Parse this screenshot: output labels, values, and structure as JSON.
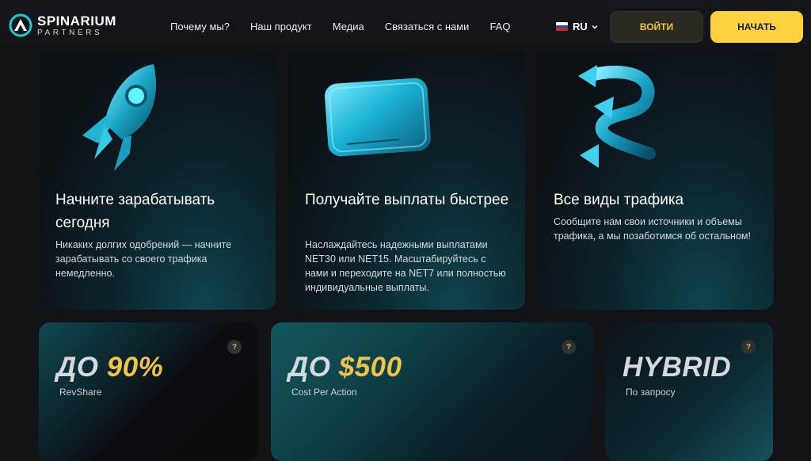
{
  "header": {
    "logo": {
      "title": "SPINARIUM",
      "subtitle": "PARTNERS"
    },
    "nav": [
      "Почему мы?",
      "Наш продукт",
      "Медиа",
      "Связаться с нами",
      "FAQ"
    ],
    "language": "RU",
    "login_label": "ВОЙТИ",
    "start_label": "НАЧАТЬ"
  },
  "features": [
    {
      "title": "Начните зарабатывать сегодня",
      "description": "Никаких долгих одобрений — начните зарабатывать со своего трафика немедленно.",
      "icon": "rocket-icon"
    },
    {
      "title": "Получайте выплаты быстрее",
      "description": "Наслаждайтесь надежными выплатами NET30 или NET15. Масштабируйтесь с нами и переходите на NET7 или полностью индивидуальные выплаты.",
      "icon": "card-icon"
    },
    {
      "title": "Все виды трафика",
      "description": "Сообщите нам свои источники и объемы трафика, а мы позаботимся об остальном!",
      "icon": "arrows-icon"
    }
  ],
  "stats": [
    {
      "prefix": "ДО",
      "value": "90%",
      "label": "RevShare"
    },
    {
      "prefix": "ДО",
      "value": "$500",
      "label": "Cost Per Action"
    },
    {
      "prefix": "",
      "value": "HYBRID",
      "label": "По запросу"
    }
  ],
  "help_symbol": "?",
  "colors": {
    "accent": "#fcd140",
    "highlight": "#f0c347",
    "teal": "#1fb8d0",
    "background": "#111316"
  }
}
